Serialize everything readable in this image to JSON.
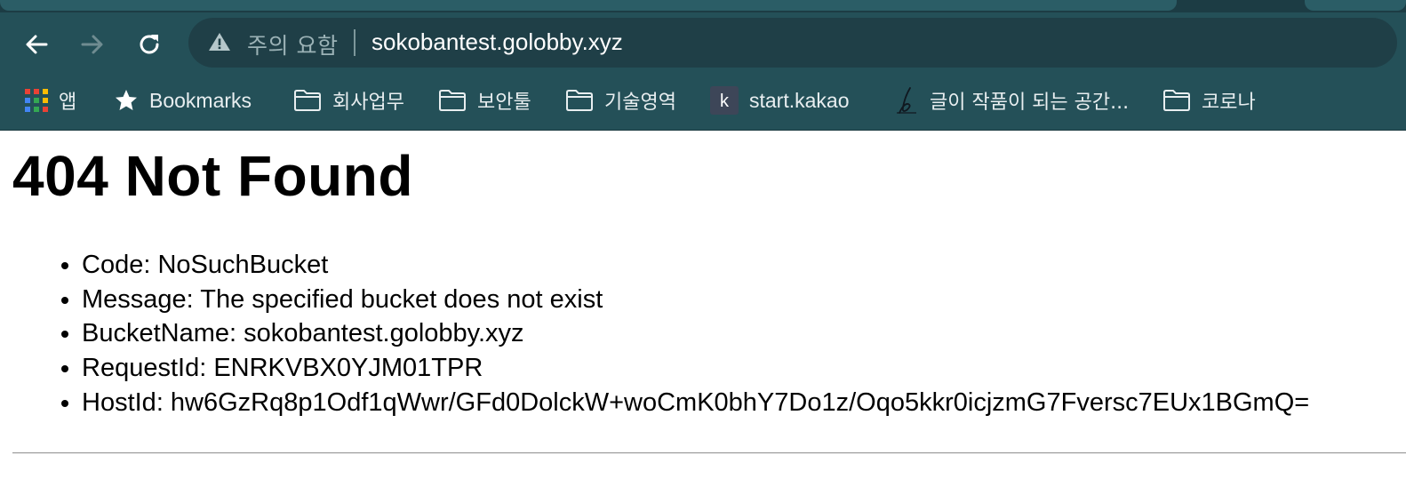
{
  "browser": {
    "nav": {
      "back": "back-arrow-icon",
      "forward": "forward-arrow-icon",
      "reload": "reload-icon"
    },
    "omnibox": {
      "security_label": "주의 요함",
      "url": "sokobantest.golobby.xyz"
    },
    "bookmarks": [
      {
        "label": "앱",
        "icon": "apps-grid-icon"
      },
      {
        "label": "Bookmarks",
        "icon": "star-icon"
      },
      {
        "label": "회사업무",
        "icon": "folder-icon"
      },
      {
        "label": "보안툴",
        "icon": "folder-icon"
      },
      {
        "label": "기술영역",
        "icon": "folder-icon"
      },
      {
        "label": "start.kakao",
        "icon": "kakao-k-icon"
      },
      {
        "label": "글이 작품이 되는 공간...",
        "icon": "brunch-pen-icon"
      },
      {
        "label": "코로나",
        "icon": "folder-icon"
      }
    ],
    "colors": {
      "chrome": "#245058",
      "omnibox": "#1f3f47"
    }
  },
  "page": {
    "title": "404 Not Found",
    "items": [
      "Code: NoSuchBucket",
      "Message: The specified bucket does not exist",
      "BucketName: sokobantest.golobby.xyz",
      "RequestId: ENRKVBX0YJM01TPR",
      "HostId: hw6GzRq8p1Odf1qWwr/GFd0DolckW+woCmK0bhY7Do1z/Oqo5kkr0icjzmG7Fversc7EUx1BGmQ="
    ]
  }
}
